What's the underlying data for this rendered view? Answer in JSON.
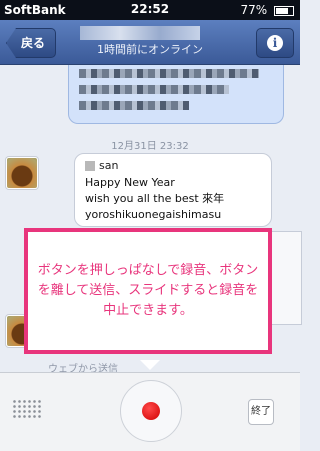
{
  "status_bar": {
    "carrier": "SoftBank",
    "time": "22:52",
    "battery": "77%"
  },
  "nav": {
    "back_label": "戻る",
    "subtitle": "1時間前にオンライン",
    "info_label": "i"
  },
  "conversation": {
    "date_separator": "12月31日 23:32",
    "message": {
      "sender": "san",
      "lines": [
        "Happy New Year",
        "wish you all the best 來年",
        "yoroshikuonegaishimasu"
      ]
    },
    "sent_from": "ウェブから送信"
  },
  "callout": {
    "text": "ボタンを押しっぱなしで録音、ボタンを離して送信、スライドすると録音を中止できます。"
  },
  "bottom": {
    "end_label": "終了",
    "record_color": "#e00000"
  },
  "colors": {
    "nav_blue": "#3b5a98",
    "highlight_pink": "#e8357c"
  }
}
